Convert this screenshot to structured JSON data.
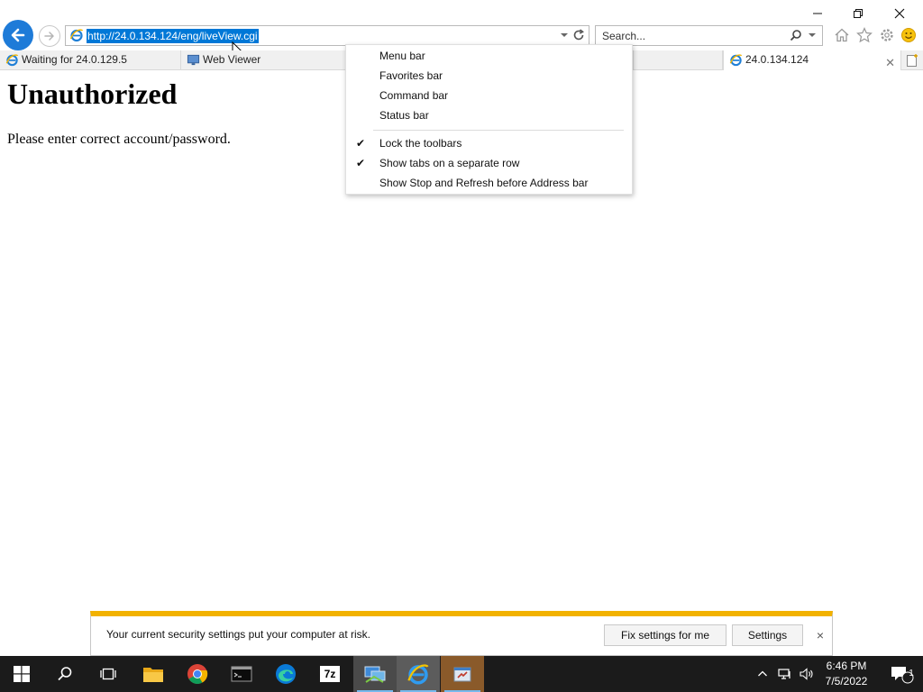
{
  "browser": {
    "url": "http://24.0.134.124/eng/liveView.cgi",
    "search_placeholder": "Search..."
  },
  "tabs": [
    {
      "label": "Waiting for 24.0.129.5"
    },
    {
      "label": "Web Viewer"
    },
    {
      "label": "24.0.134.124"
    }
  ],
  "page": {
    "heading": "Unauthorized",
    "message": "Please enter correct account/password."
  },
  "context_menu": {
    "items": [
      {
        "label": "Menu bar",
        "checked": false
      },
      {
        "label": "Favorites bar",
        "checked": false
      },
      {
        "label": "Command bar",
        "checked": false
      },
      {
        "label": "Status bar",
        "checked": false
      },
      {
        "label": "Lock the toolbars",
        "checked": true
      },
      {
        "label": "Show tabs on a separate row",
        "checked": true
      },
      {
        "label": "Show Stop and Refresh before Address bar",
        "checked": false
      }
    ],
    "check_glyph": "✔"
  },
  "notification": {
    "message": "Your current security settings put your computer at risk.",
    "fix_button": "Fix settings for me",
    "settings_button": "Settings",
    "close_glyph": "×"
  },
  "taskbar": {
    "apps": [
      "start-icon",
      "search-icon",
      "task-view-icon",
      "file-explorer-icon",
      "chrome-icon",
      "terminal-icon",
      "edge-icon",
      "7zip-icon",
      "network-app-icon",
      "internet-explorer-icon",
      "tools-app-icon"
    ],
    "sevenzip_label": "7z",
    "clock_time": "6:46 PM",
    "clock_date": "7/5/2022",
    "notification_count": "1"
  },
  "colors": {
    "accent": "#0078d7",
    "warning": "#f2b200",
    "taskbar": "#1b1b1b"
  }
}
